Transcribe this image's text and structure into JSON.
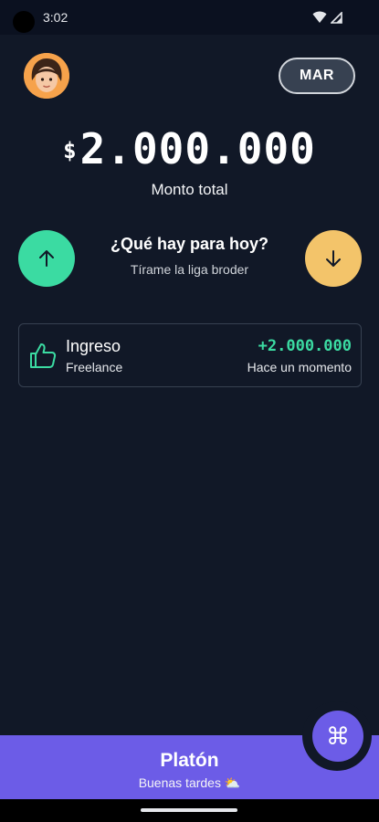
{
  "status": {
    "time": "3:02"
  },
  "header": {
    "month_label": "MAR"
  },
  "balance": {
    "currency_symbol": "$",
    "amount": "2.000.000",
    "label": "Monto total"
  },
  "prompt": {
    "question": "¿Qué hay para hoy?",
    "subtitle": "Tírame la liga broder"
  },
  "transactions": [
    {
      "title": "Ingreso",
      "category": "Freelance",
      "amount": "+2.000.000",
      "time": "Hace un momento"
    }
  ],
  "footer": {
    "user_name": "Platón",
    "greeting": "Buenas tardes ⛅",
    "fab_symbol": "⌘"
  },
  "colors": {
    "background": "#111827",
    "income": "#3bdba2",
    "expense": "#f3c46a",
    "accent": "#6c5ce7"
  },
  "icons": {
    "income_button": "arrow-up-icon",
    "expense_button": "arrow-down-icon",
    "transaction": "thumbs-up-icon",
    "fab": "command-icon",
    "status": [
      "wifi-icon",
      "signal-icon"
    ]
  }
}
